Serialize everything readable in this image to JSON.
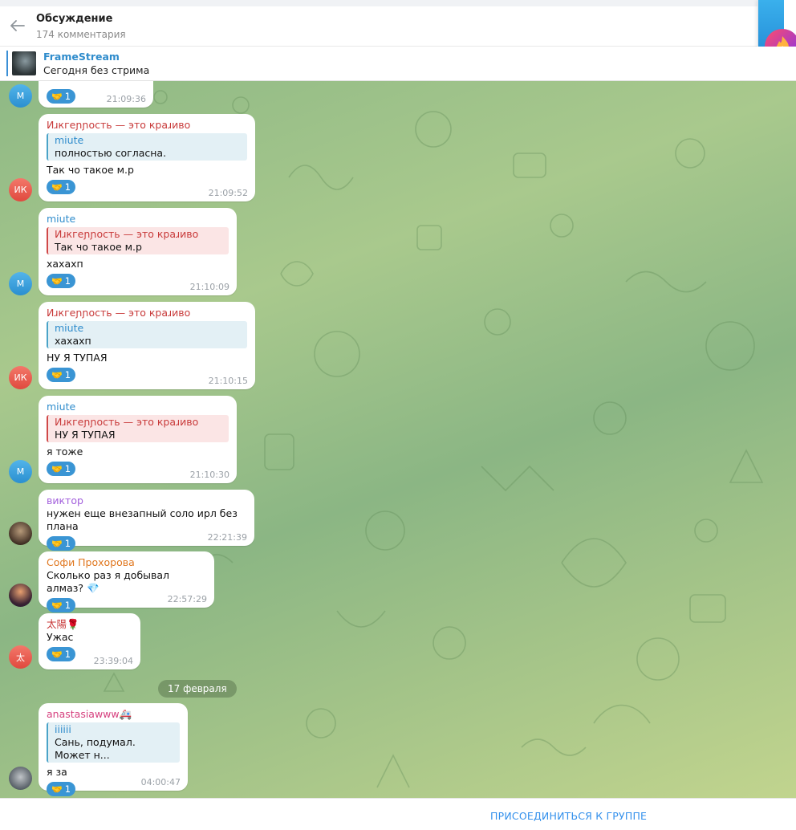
{
  "header": {
    "title": "Обсуждение",
    "subtitle": "174 комментария"
  },
  "pinned": {
    "name": "FrameStream",
    "text": "Сегодня без стрима"
  },
  "colors": {
    "accent": "#3390ec",
    "reaction": "#3a95d4",
    "red_name": "#c83a3a",
    "blue_name": "#2f8ccc",
    "purple_name": "#a25fdc",
    "orange_name": "#e0771f",
    "pink_name": "#d6417f"
  },
  "messages": [
    {
      "avatar": "М",
      "reaction_emoji": "🤝",
      "reaction_count": "1",
      "time": "21:09:36"
    },
    {
      "sender": "Иɹкгеɲɲость — это краɹиво",
      "reply_name": "miute",
      "reply_text": "полностью согласна.",
      "text": "Так чо такое м.р",
      "avatar": "ИК",
      "reaction_emoji": "🤝",
      "reaction_count": "1",
      "time": "21:09:52"
    },
    {
      "sender": "miute",
      "reply_name": "Иɹкгеɲɲость — это краɹиво",
      "reply_text": "Так чо такое м.р",
      "text": "хахахп",
      "avatar": "М",
      "reaction_emoji": "🤝",
      "reaction_count": "1",
      "time": "21:10:09"
    },
    {
      "sender": "Иɹкгеɲɲость — это краɹиво",
      "reply_name": "miute",
      "reply_text": "хахахп",
      "text": "НУ Я ТУПАЯ",
      "avatar": "ИК",
      "reaction_emoji": "🤝",
      "reaction_count": "1",
      "time": "21:10:15"
    },
    {
      "sender": "miute",
      "reply_name": "Иɹкгеɲɲость — это краɹиво",
      "reply_text": "НУ Я ТУПАЯ",
      "text": "я тоже",
      "avatar": "М",
      "reaction_emoji": "🤝",
      "reaction_count": "1",
      "time": "21:10:30"
    },
    {
      "sender": "виктор",
      "text": "нужен еще внезапный соло ирл без плана",
      "reaction_emoji": "🤝",
      "reaction_count": "1",
      "time": "22:21:39"
    },
    {
      "sender": "Софи Прохорова",
      "text": "Сколько раз я добывал алмаз? 💎",
      "reaction_emoji": "🤝",
      "reaction_count": "1",
      "time": "22:57:29"
    },
    {
      "sender": "太陽🌹",
      "text": "Ужас",
      "avatar": "太",
      "reaction_emoji": "🤝",
      "reaction_count": "1",
      "time": "23:39:04"
    },
    {
      "sender": "anastasiawww🚑",
      "reply_name": "iiiiii",
      "reply_text": "Сань, подумал. Может н...",
      "text": "я за",
      "reaction_emoji": "🤝",
      "reaction_count": "1",
      "time": "04:00:47"
    }
  ],
  "date_separator": "17 февраля",
  "footer": {
    "join_label": "ПРИСОЕДИНИТЬСЯ К ГРУППЕ"
  }
}
